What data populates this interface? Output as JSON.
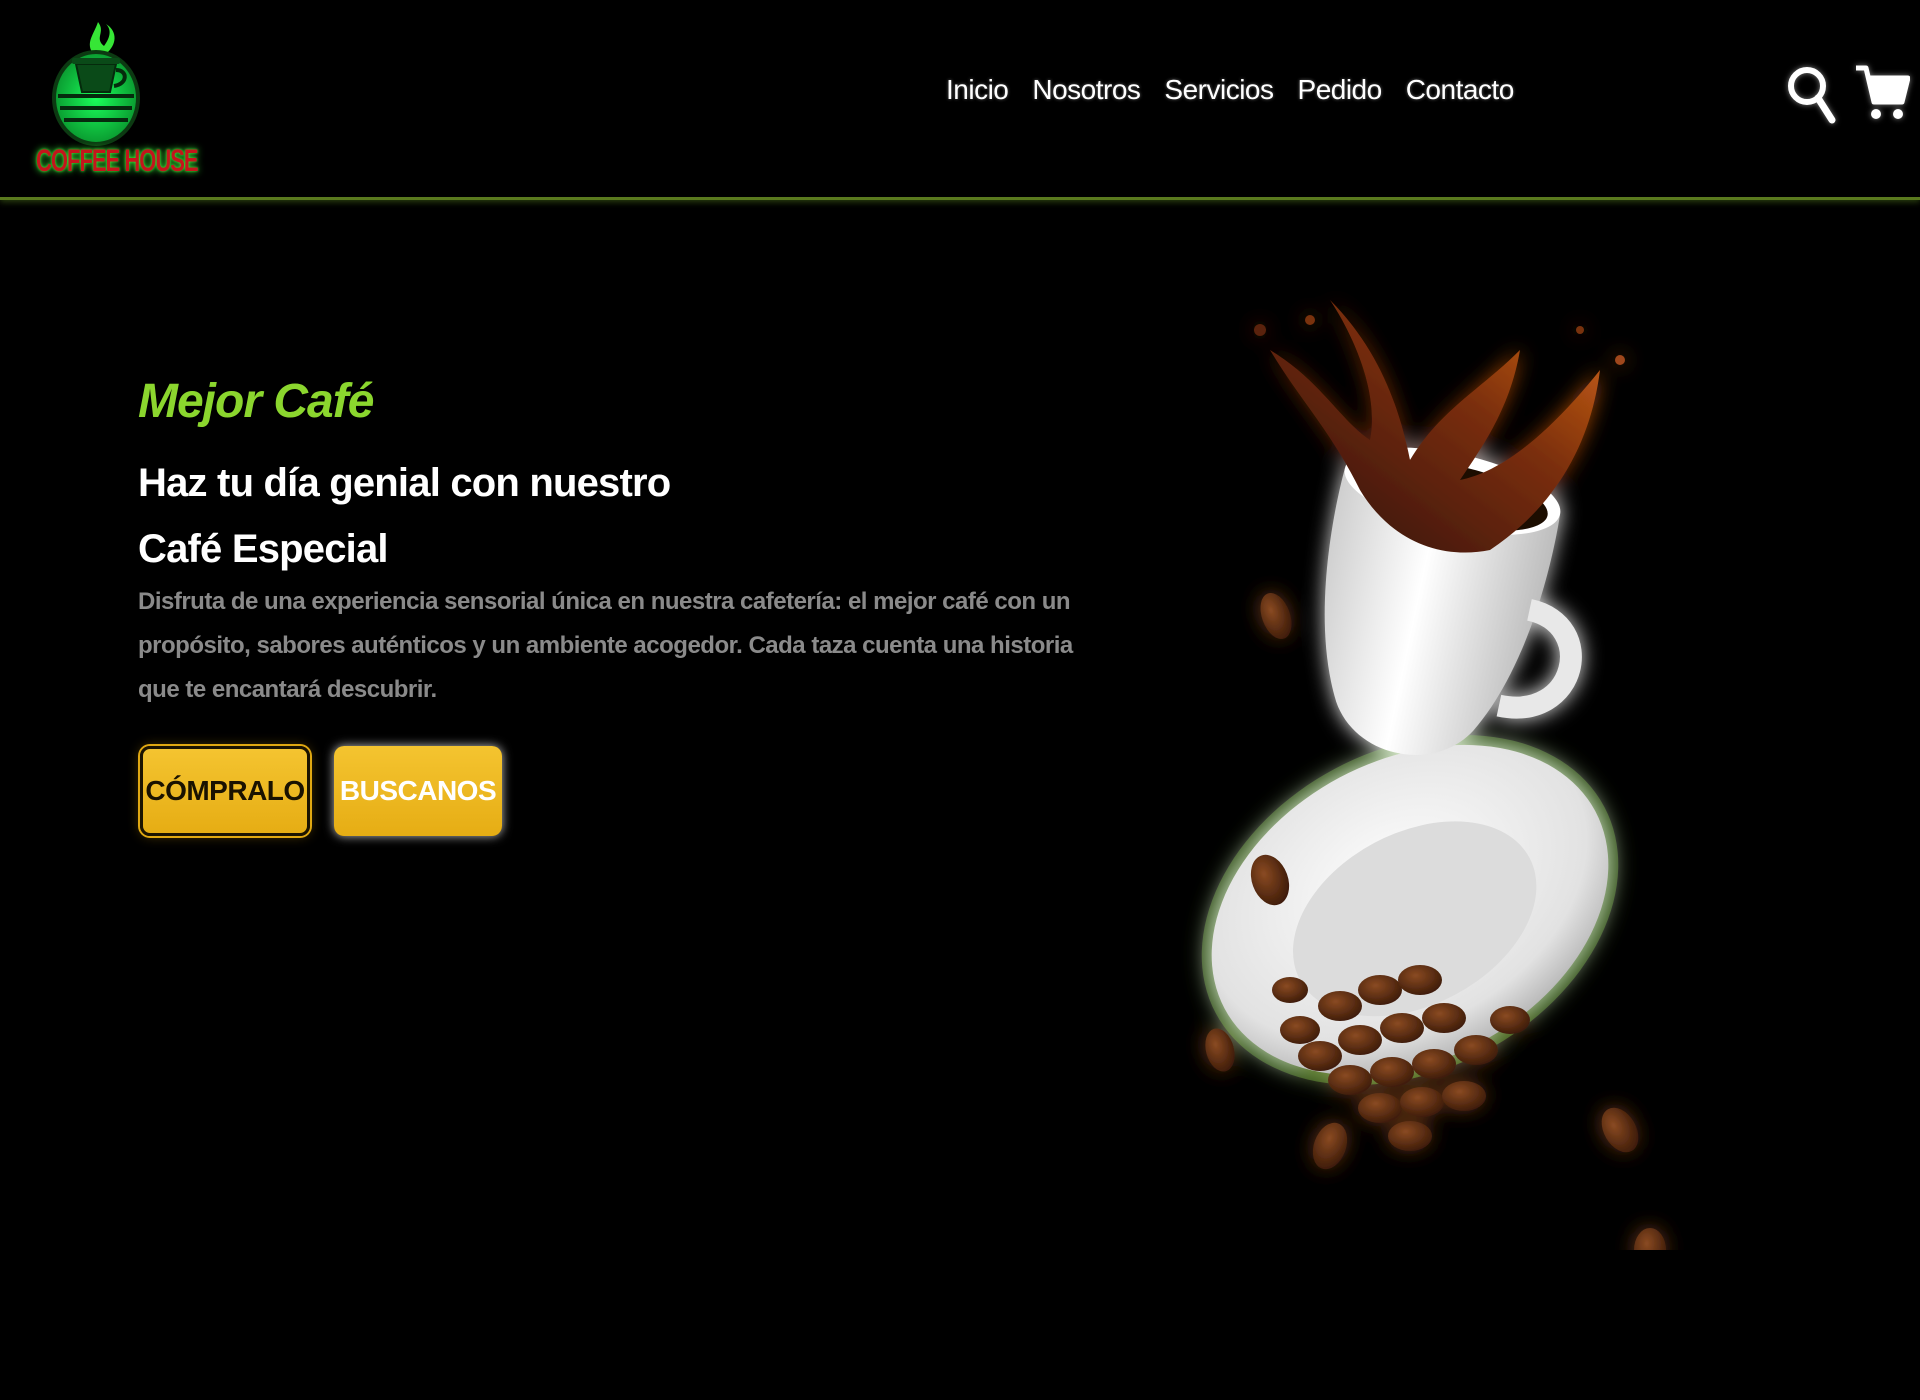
{
  "brand": {
    "logo_text": "COFFEE HOUSE",
    "accent_color": "#8bd62e",
    "logo_text_color": "#c4161c",
    "button_color": "#f4c430"
  },
  "nav": {
    "items": [
      {
        "label": "Inicio"
      },
      {
        "label": "Nosotros"
      },
      {
        "label": "Servicios"
      },
      {
        "label": "Pedido"
      },
      {
        "label": "Contacto"
      }
    ]
  },
  "header_icons": {
    "search": "search-icon",
    "cart": "cart-icon"
  },
  "hero": {
    "eyebrow": "Mejor Café",
    "title_line1": "Haz tu día genial con nuestro",
    "title_line2": "Café Especial",
    "description": "Disfruta de una experiencia sensorial única en nuestra cafetería: el mejor café con un propósito, sabores auténticos y un ambiente acogedor. Cada taza cuenta una historia que te encantará descubrir.",
    "buttons": {
      "buy": "CÓMPRALO",
      "find": "BUSCANOS"
    },
    "image": "coffee-cup-splash-with-beans"
  }
}
